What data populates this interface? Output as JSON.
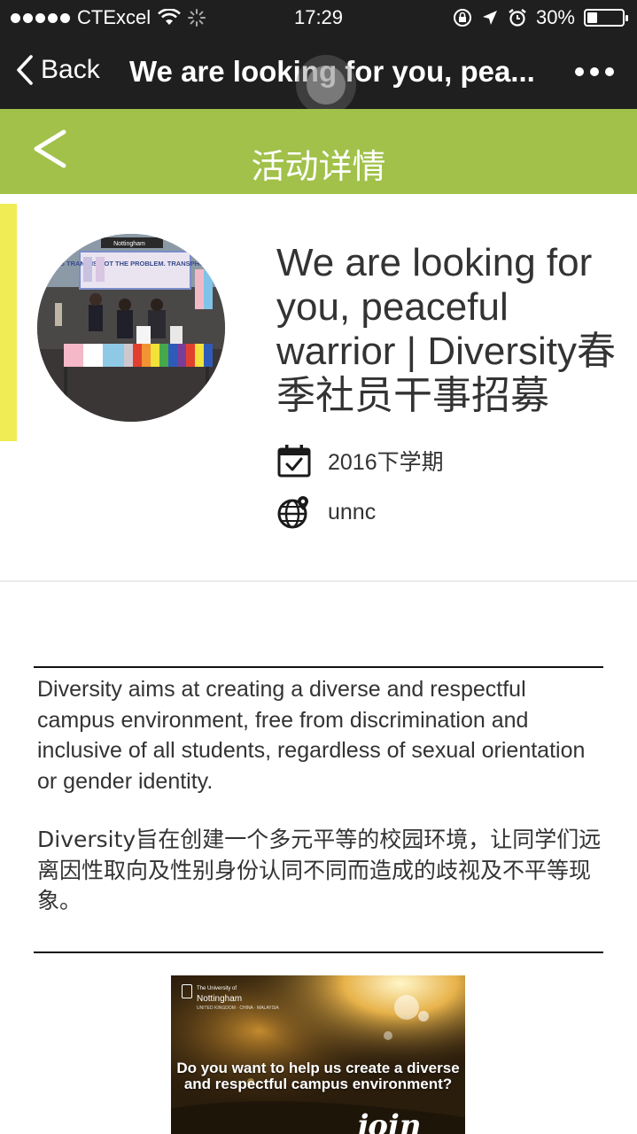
{
  "status_bar": {
    "carrier": "CTExcel",
    "time": "17:29",
    "battery": "30%",
    "battery_level": 0.3
  },
  "nav": {
    "back_label": "Back",
    "title": "We are looking for you, pea..."
  },
  "page_header": {
    "title": "活动详情"
  },
  "event": {
    "title": "We are looking for you, peaceful warrior | Diversity春季社员干事招募",
    "date": "2016下学期",
    "location": "unnc",
    "photo_banner": "BEING TRANS IS NOT THE PROBLEM. TRANSPHOBIA IS.",
    "photo_logo": "Nottingham"
  },
  "description": {
    "english": "Diversity aims at creating a diverse and respectful campus environment, free from discrimination and inclusive of all students, regardless of sexual orientation or gender identity.",
    "chinese": "Diversity旨在创建一个多元平等的校园环境，让同学们远离因性取向及性别身份认同不同而造成的歧视及不平等现象。"
  },
  "poster": {
    "logo_line1": "The University of",
    "logo_line2": "Nottingham",
    "logo_line3": "UNITED KINGDOM · CHINA · MALAYSIA",
    "headline": "Do you want to help us create a diverse and respectful campus environment?",
    "script_text": "join us!"
  },
  "colors": {
    "nav_bg": "#1f1f1f",
    "header_green": "#a1c14a",
    "accent_yellow": "#efec55"
  }
}
